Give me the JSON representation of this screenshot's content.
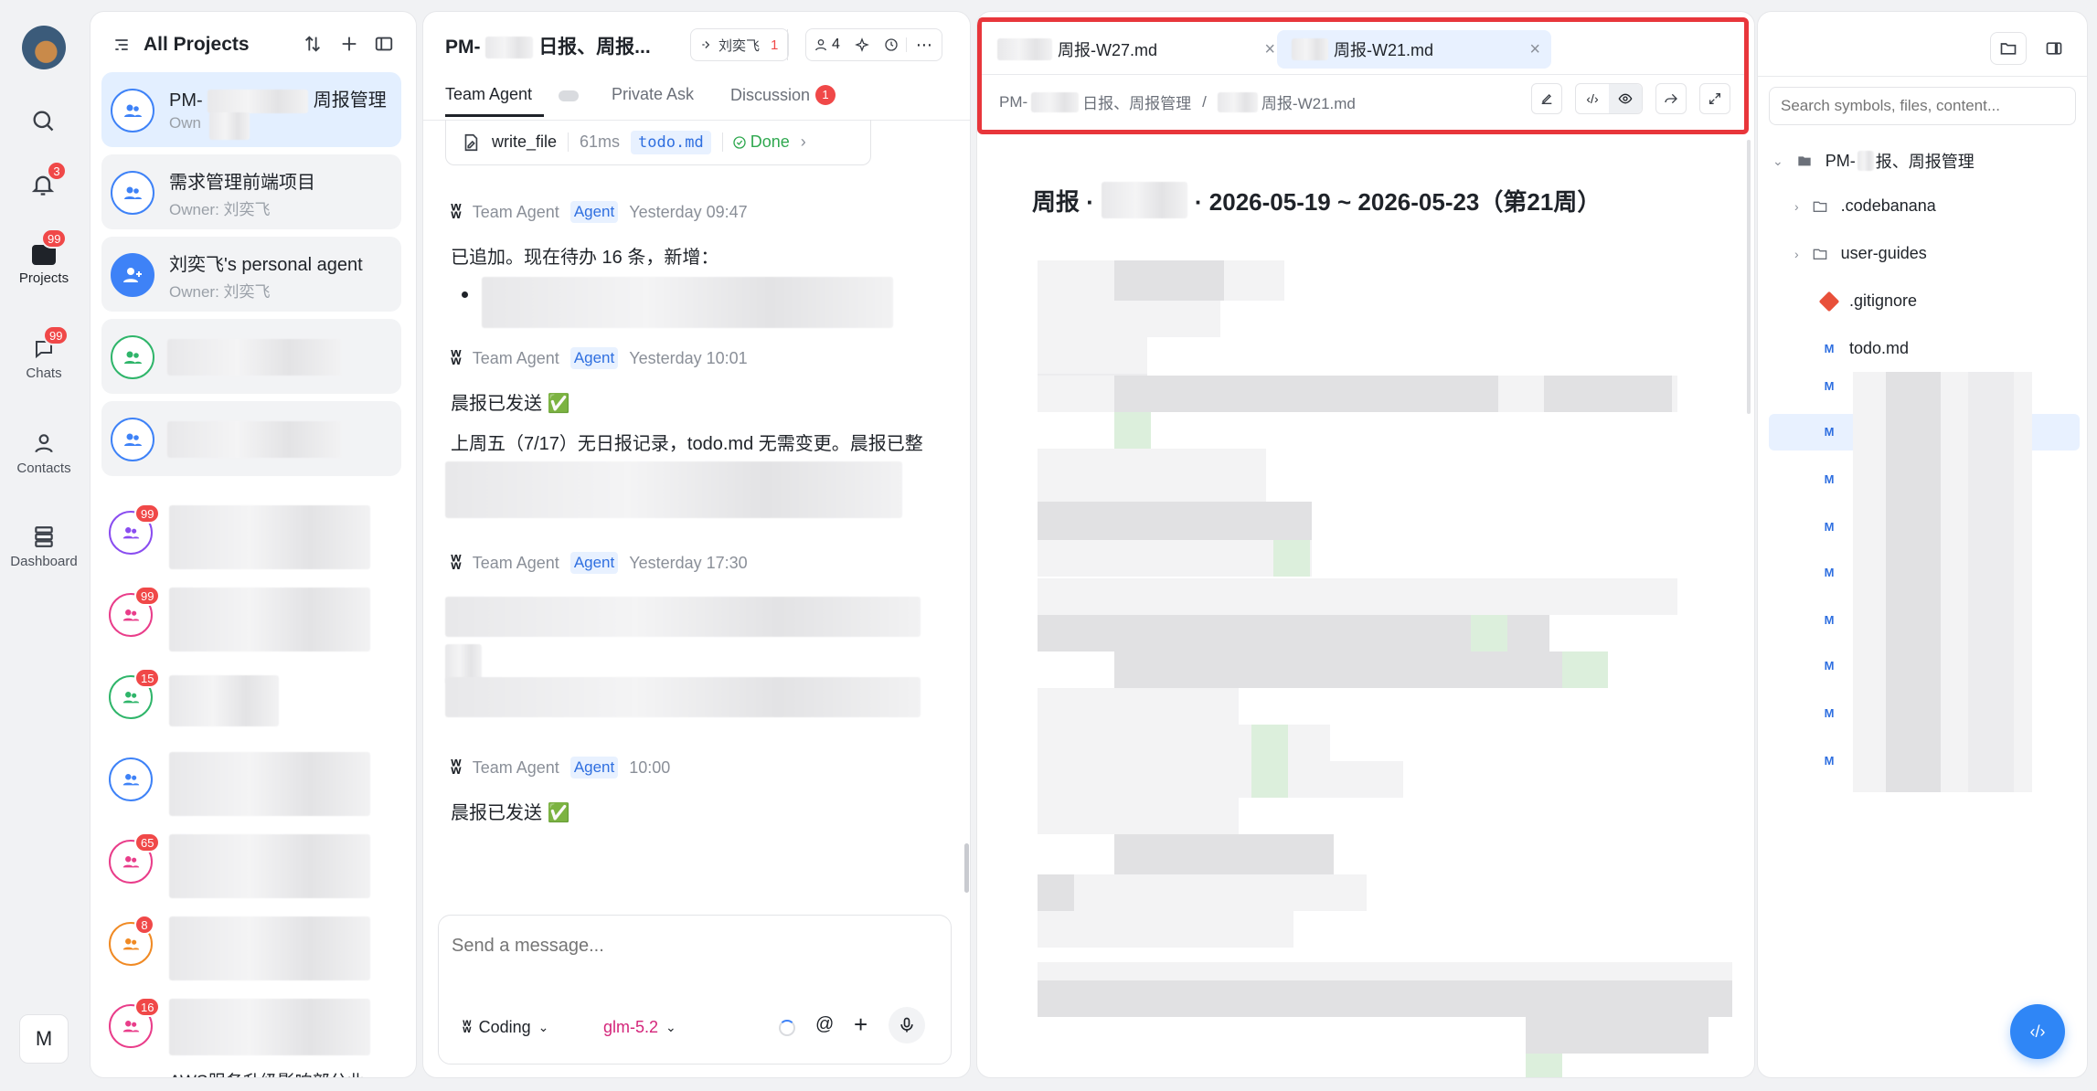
{
  "nav": {
    "avatar_initial": "",
    "notifications_badge": "3",
    "projects_label": "Projects",
    "projects_badge": "99",
    "chats_label": "Chats",
    "chats_badge": "99",
    "contacts_label": "Contacts",
    "dashboard_label": "Dashboard",
    "user_initial": "M"
  },
  "projects": {
    "title": "All Projects",
    "items": [
      {
        "name": "PM-",
        "name_suffix": "周报管理",
        "owner": "Own"
      },
      {
        "name": "需求管理前端项目",
        "owner": "Owner: 刘奕飞"
      },
      {
        "name": "刘奕飞's personal agent",
        "owner": "Owner: 刘奕飞"
      }
    ],
    "badges": [
      "99",
      "99",
      "15",
      "65",
      "8",
      "16"
    ],
    "last_item_text": "AWS服务升级影响部分业..."
  },
  "chat": {
    "title_prefix": "PM-",
    "title_suffix": "日报、周报...",
    "user_chip": "刘奕飞",
    "user_chip_count": "1",
    "members_count": "4",
    "tabs": [
      {
        "label": "Team Agent"
      },
      {
        "label": "Private Ask"
      },
      {
        "label": "Discussion",
        "badge": "1"
      }
    ],
    "tool": {
      "name": "write_file",
      "duration": "61ms",
      "file": "todo.md",
      "status": "Done"
    },
    "messages": [
      {
        "sender": "Team Agent",
        "tag": "Agent",
        "time": "Yesterday 09:47",
        "text": "已追加。现在待办 16 条，新增："
      },
      {
        "sender": "Team Agent",
        "tag": "Agent",
        "time": "Yesterday 10:01",
        "text": "晨报已发送 ✅",
        "text2": "上周五（7/17）无日报记录，todo.md 无需变更。晨报已整"
      },
      {
        "sender": "Team Agent",
        "tag": "Agent",
        "time": "Yesterday 17:30"
      },
      {
        "sender": "Team Agent",
        "tag": "Agent",
        "time": "10:00",
        "text": "晨报已发送 ✅"
      }
    ],
    "input_placeholder": "Send a message...",
    "mode": "Coding",
    "model": "glm-5.2"
  },
  "editor": {
    "tabs": [
      {
        "label": "周报-W27.md"
      },
      {
        "label": "周报-W21.md"
      }
    ],
    "breadcrumb_root": "PM-",
    "breadcrumb_root_suffix": "日报、周报管理",
    "breadcrumb_sep": "/",
    "breadcrumb_file": "周报-W21.md",
    "doc_title_prefix": "周报 ·",
    "doc_title_suffix": "· 2026-05-19 ~ 2026-05-23（第21周）"
  },
  "files": {
    "search_placeholder": "Search symbols, files, content...",
    "root_prefix": "PM-",
    "root_suffix": "报、周报管理",
    "items": [
      {
        "name": ".codebanana",
        "type": "folder"
      },
      {
        "name": "user-guides",
        "type": "folder"
      },
      {
        "name": ".gitignore",
        "type": "git"
      },
      {
        "name": "todo.md",
        "type": "md"
      }
    ],
    "md_label": "M"
  },
  "colors": {
    "accent": "#3e82f7",
    "highlight_border": "#e8363b",
    "badge": "#f04848",
    "done": "#2fa84f"
  }
}
